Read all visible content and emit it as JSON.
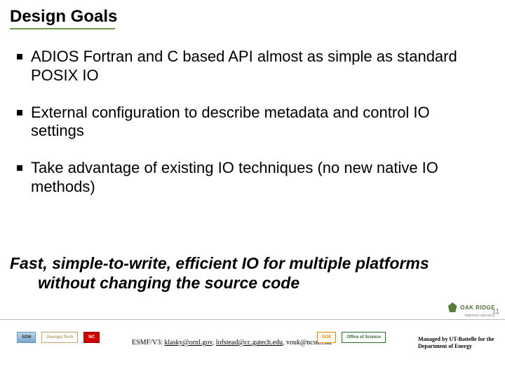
{
  "title": "Design Goals",
  "bullets": [
    "ADIOS Fortran and C based API almost as simple as standard POSIX IO",
    "External configuration to describe metadata and control IO settings",
    "Take advantage of existing IO techniques (no new native IO methods)"
  ],
  "summary": "Fast, simple-to-write, efficient IO for multiple platforms without changing the source code",
  "page_number": "11",
  "footer": {
    "logos_left": [
      {
        "name": "sdm-logo",
        "label": "SDM"
      },
      {
        "name": "georgia-tech-logo",
        "label": "Georgia Tech"
      },
      {
        "name": "ncsu-logo",
        "label": "NC"
      }
    ],
    "contact_prefix": "ESMF/V3: ",
    "contacts": [
      {
        "text": "klasky@ornl.gov",
        "sep": ", "
      },
      {
        "text": "lofstead@cc.gatech.edu",
        "sep": ", "
      },
      {
        "text": "vouk@ncsu.edu",
        "sep": ""
      }
    ],
    "logos_right": [
      {
        "name": "doe-seal",
        "label": "DOE"
      },
      {
        "name": "office-of-science-logo",
        "label": "Office of Science"
      }
    ],
    "ornl_label": "OAK RIDGE",
    "ornl_sub": "National Laboratory",
    "managed_by": "Managed by UT-Battelle for the Department of Energy"
  }
}
